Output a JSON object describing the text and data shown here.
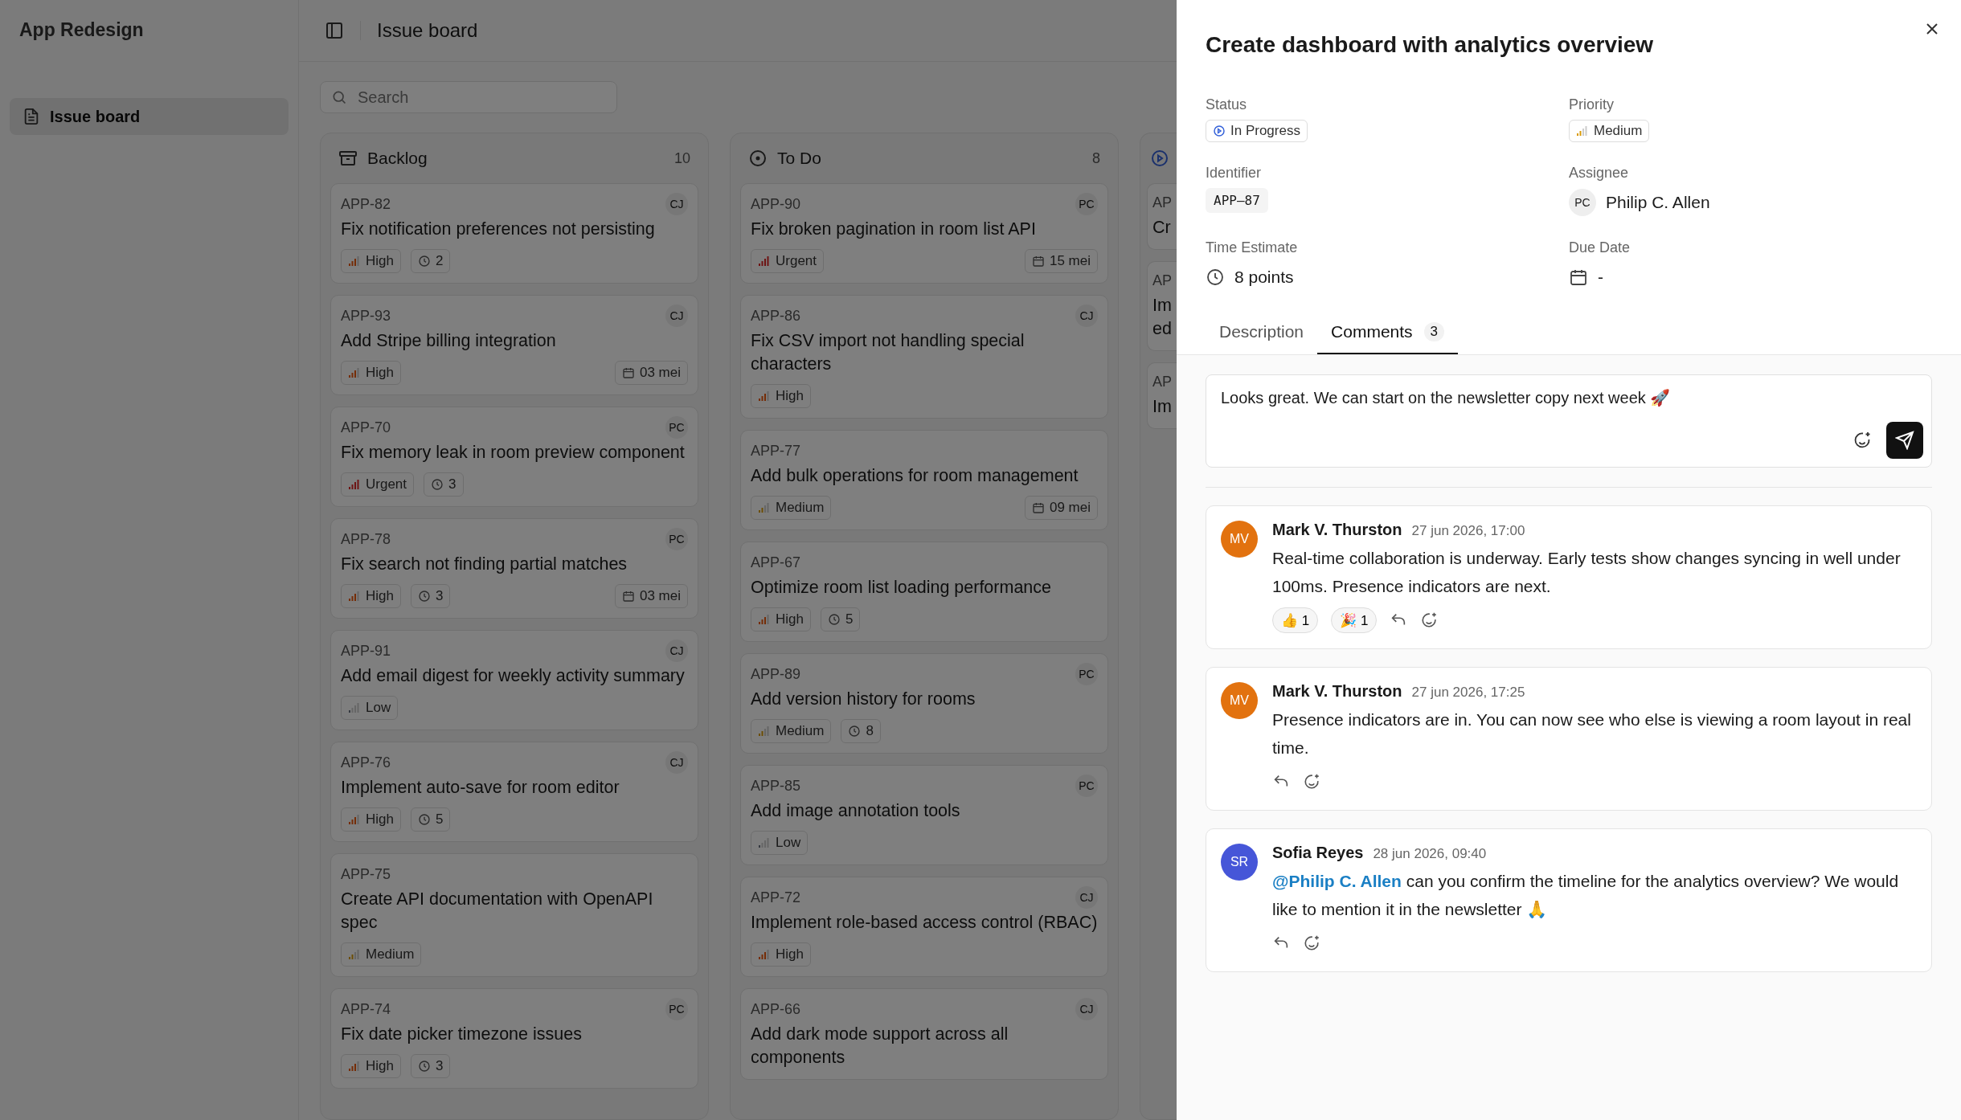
{
  "app": {
    "title": "App Redesign"
  },
  "sidebar": {
    "items": [
      {
        "label": "Issue board",
        "selected": true
      }
    ]
  },
  "header": {
    "title": "Issue board"
  },
  "search": {
    "placeholder": "Search"
  },
  "columns": [
    {
      "kind": "backlog",
      "title": "Backlog",
      "count": "10",
      "cards": [
        {
          "id": "APP-82",
          "title": "Fix notification preferences not persisting",
          "assignee": "CJ",
          "priority": {
            "kind": "high",
            "label": "High"
          },
          "estimate": "2"
        },
        {
          "id": "APP-93",
          "title": "Add Stripe billing integration",
          "assignee": "CJ",
          "priority": {
            "kind": "high",
            "label": "High"
          },
          "due": "03 mei"
        },
        {
          "id": "APP-70",
          "title": "Fix memory leak in room preview component",
          "assignee": "PC",
          "priority": {
            "kind": "urgent",
            "label": "Urgent"
          },
          "estimate": "3"
        },
        {
          "id": "APP-78",
          "title": "Fix search not finding partial matches",
          "assignee": "PC",
          "priority": {
            "kind": "high",
            "label": "High"
          },
          "estimate": "3",
          "due": "03 mei"
        },
        {
          "id": "APP-91",
          "title": "Add email digest for weekly activity summary",
          "assignee": "CJ",
          "priority": {
            "kind": "low",
            "label": "Low"
          }
        },
        {
          "id": "APP-76",
          "title": "Implement auto-save for room editor",
          "assignee": "CJ",
          "priority": {
            "kind": "high",
            "label": "High"
          },
          "estimate": "5"
        },
        {
          "id": "APP-75",
          "title": "Create API documentation with OpenAPI spec",
          "priority": {
            "kind": "medium",
            "label": "Medium"
          }
        },
        {
          "id": "APP-74",
          "title": "Fix date picker timezone issues",
          "assignee": "PC",
          "priority": {
            "kind": "high",
            "label": "High"
          },
          "estimate": "3"
        }
      ]
    },
    {
      "kind": "todo",
      "title": "To Do",
      "count": "8",
      "cards": [
        {
          "id": "APP-90",
          "title": "Fix broken pagination in room list API",
          "assignee": "PC",
          "priority": {
            "kind": "urgent",
            "label": "Urgent"
          },
          "due": "15 mei"
        },
        {
          "id": "APP-86",
          "title": "Fix CSV import not handling special characters",
          "assignee": "CJ",
          "priority": {
            "kind": "high",
            "label": "High"
          }
        },
        {
          "id": "APP-77",
          "title": "Add bulk operations for room management",
          "priority": {
            "kind": "medium",
            "label": "Medium"
          },
          "due": "09 mei"
        },
        {
          "id": "APP-67",
          "title": "Optimize room list loading performance",
          "priority": {
            "kind": "high",
            "label": "High"
          },
          "estimate": "5"
        },
        {
          "id": "APP-89",
          "title": "Add version history for rooms",
          "assignee": "PC",
          "priority": {
            "kind": "medium",
            "label": "Medium"
          },
          "estimate": "8"
        },
        {
          "id": "APP-85",
          "title": "Add image annotation tools",
          "assignee": "PC",
          "priority": {
            "kind": "low",
            "label": "Low"
          }
        },
        {
          "id": "APP-72",
          "title": "Implement role-based access control (RBAC)",
          "assignee": "CJ",
          "priority": {
            "kind": "high",
            "label": "High"
          }
        },
        {
          "id": "APP-66",
          "title": "Add dark mode support across all components",
          "assignee": "CJ"
        }
      ]
    },
    {
      "kind": "in_progress",
      "cards": [
        {
          "id": "AP",
          "title": "Cr"
        },
        {
          "id": "AP",
          "title": "Im ed"
        },
        {
          "id": "AP",
          "title": "Im"
        }
      ]
    }
  ],
  "panel": {
    "title": "Create dashboard with analytics overview",
    "status": {
      "label": "Status",
      "value": "In Progress"
    },
    "priority": {
      "label": "Priority",
      "value": "Medium",
      "kind": "medium"
    },
    "identifier": {
      "label": "Identifier",
      "value": "APP–87"
    },
    "assignee": {
      "label": "Assignee",
      "initials": "PC",
      "name": "Philip C. Allen"
    },
    "estimate": {
      "label": "Time Estimate",
      "value": "8 points"
    },
    "due": {
      "label": "Due Date",
      "value": "-"
    },
    "tabs": [
      {
        "label": "Description",
        "selected": false
      },
      {
        "label": "Comments",
        "count": "3",
        "selected": true
      }
    ],
    "composer": {
      "value": "Looks great. We can start on the newsletter copy next week 🚀"
    },
    "comments": [
      {
        "initials": "MV",
        "color": "#e2720f",
        "author": "Mark V. Thurston",
        "time": "27 jun 2026, 17:00",
        "text": "Real-time collaboration is underway. Early tests show changes syncing in well under 100ms. Presence indicators are next.",
        "reactions": [
          {
            "emoji": "👍",
            "count": "1"
          },
          {
            "emoji": "🎉",
            "count": "1"
          }
        ]
      },
      {
        "initials": "MV",
        "color": "#e2720f",
        "author": "Mark V. Thurston",
        "time": "27 jun 2026, 17:25",
        "text": "Presence indicators are in. You can now see who else is viewing a room layout in real time."
      },
      {
        "initials": "SR",
        "color": "#4656d8",
        "author": "Sofia Reyes",
        "time": "28 jun 2026, 09:40",
        "mention": "@Philip C. Allen",
        "text": "can you confirm the timeline for the analytics overview? We would like to mention it in the newsletter 🙏"
      }
    ]
  }
}
